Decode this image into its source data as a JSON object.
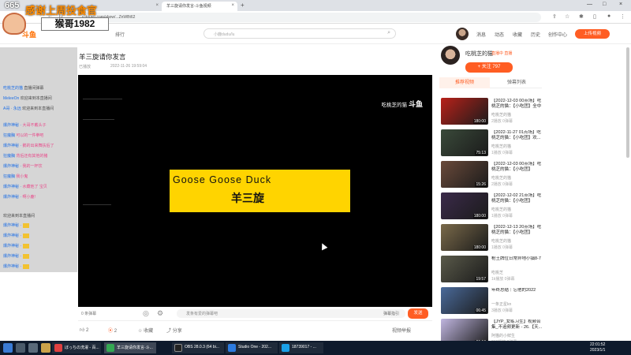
{
  "browser": {
    "tabs": [
      {
        "title": "羊三旋请你发言-斗鱼视频"
      },
      {
        "title": ""
      }
    ],
    "url": "v.douyu.com/show/...ZnWBt62"
  },
  "overlay": {
    "badge": "665",
    "title": "感谢上周投食官",
    "name": "猴哥1982"
  },
  "site": {
    "logo": "斗鱼",
    "nav": [
      "排行"
    ],
    "search_placeholder": "小鹿dudu/lu",
    "links": [
      "消息",
      "动态",
      "收藏",
      "历史",
      "创作中心"
    ],
    "upload_label": "上传视频"
  },
  "chat": {
    "rows": [
      {
        "user": "",
        "text": "吃桃芝的猫",
        "extra": "直播间弹幕"
      },
      {
        "user": "MeleeOn",
        "text": "欢迎来到本直播间"
      },
      {
        "user": "A哥 · 永远",
        "text": "欢迎来到本直播间"
      },
      {
        "user": "爆炸神秘 ·",
        "text": "大哥不戴头子"
      },
      {
        "user": "狂魔胸",
        "text": "可以的一件拳吧"
      },
      {
        "user": "爆炸神秘 ·",
        "text": "鹅的出来舞扶后了"
      },
      {
        "user": "狂魔胸",
        "text": "背后还有其他的猪"
      },
      {
        "user": "爆炸神秘 ·",
        "text": "我的一杯饮"
      },
      {
        "user": "狂魔胸",
        "text": "我小鬼"
      },
      {
        "user": "爆炸神秘 ·",
        "text": "水藏他了 宝贝"
      },
      {
        "user": "爆炸神秘 ·",
        "text": "啊小鹿!"
      }
    ],
    "notice": "欢迎来到本直播间"
  },
  "video": {
    "title": "羊三旋请你发言",
    "meta": "已播放",
    "date": "2022-11-26 19:59:04",
    "watermark": "吃桃芝的猫",
    "watermark_brand": "斗鱼",
    "overlay_text": "Goose Goose Duck",
    "overlay_sub": "羊三旋",
    "danmu_placeholder": "发条有爱的弹幕吧",
    "danmu_settings": "弹幕指引",
    "send_label": "发送",
    "control_left": "0 条弹幕"
  },
  "actions": {
    "like_count": "2",
    "coin_count": "2",
    "collect": "收藏",
    "share": "分享",
    "report": "视频举报"
  },
  "uploader": {
    "name": "吃桃芝的猫",
    "links": "直播中  直播",
    "follow_label": "+ 关注  797"
  },
  "right_tabs": [
    "推荐视频",
    "弹幕列表"
  ],
  "recommendations": [
    {
      "title": "【2022-12-03 00点场】吃桃芝的猫：【小吃团】全中",
      "up": "吃桃芝的猫",
      "stat": "2播放  0弹幕",
      "dur": "180:00"
    },
    {
      "title": "【2022-11-27 01点场】吃桃芝的猫：【小吃团】欢...",
      "up": "吃桃芝的猫",
      "stat": "1播放  0弹幕",
      "dur": "75:13"
    },
    {
      "title": "【2022-12-03 00点场】吃桃芝的猫：【小吃团】",
      "up": "吃桃芝的猫",
      "stat": "2播放  0弹幕",
      "dur": "15:26"
    },
    {
      "title": "【2022-12-02 21点场】吃桃芝的猫：【小吃团】",
      "up": "吃桃芝的猫",
      "stat": "1播放  0弹幕",
      "dur": "180:00"
    },
    {
      "title": "【2022-12-13 20点场】吃桃芝的猫：【小吃团】",
      "up": "吃桃芝的猫",
      "stat": "1播放  0弹幕",
      "dur": "180:00"
    },
    {
      "title": "枪王牌位日常异地小镇8-7",
      "up": "吃桃芝",
      "stat": "1k播放  0弹幕",
      "dur": "19:57"
    },
    {
      "title": "年终总结｜忘他的2022",
      "up": "一条正星kn",
      "stat": "3播放  0弹幕",
      "dur": "06:45"
    },
    {
      "title": "【JYP_女练习生】视频合集_不追频更新 - 26.【天...",
      "up": "阿猫的小鲜生",
      "stat": "219播放  0弹幕",
      "dur": "06:18"
    }
  ],
  "taskbar": {
    "items": [
      {
        "label": "ぼっちの洗濯 - 百..."
      },
      {
        "label": "羊三旋请你发言-斗..."
      },
      {
        "label": "OBS 28.0.3 (64 bi..."
      },
      {
        "label": "Studio One - 202..."
      },
      {
        "label": "18739017 - ..."
      }
    ],
    "time": "22:01:52",
    "date": "2023/1/1"
  }
}
